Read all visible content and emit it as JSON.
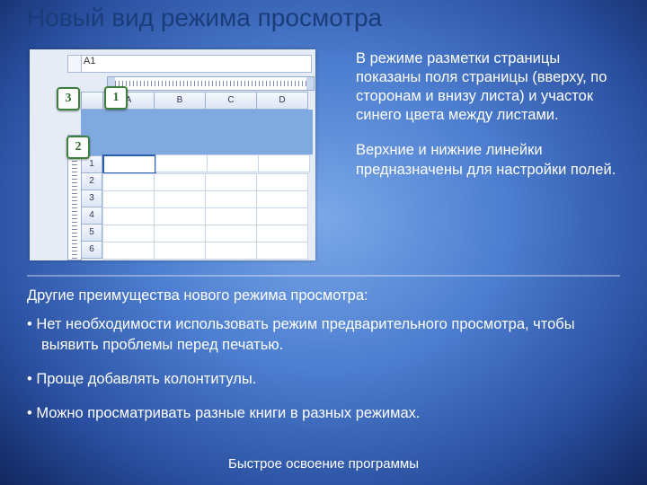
{
  "title": "Новый вид режима просмотра",
  "right": {
    "p1": "В режиме разметки страницы показаны поля страницы (вверху, по сторонам и внизу листа) и участок синего цвета между листами.",
    "p2": "Верхние и нижние линейки предназначены для настройки полей."
  },
  "lower": {
    "sub": "Другие преимущества нового режима просмотра:",
    "bullets": [
      "Нет необходимости использовать режим предварительного просмотра, чтобы выявить проблемы перед печатью.",
      "Проще добавлять колонтитулы.",
      "Можно просматривать разные книги в разных режимах."
    ]
  },
  "footer": "Быстрое освоение программы",
  "screenshot": {
    "cell_ref": "A1",
    "cols": [
      "A",
      "B",
      "C",
      "D"
    ],
    "rows": [
      "1",
      "2",
      "3",
      "4",
      "5",
      "6"
    ],
    "badges": {
      "b1": "1",
      "b2": "2",
      "b3": "3"
    }
  }
}
